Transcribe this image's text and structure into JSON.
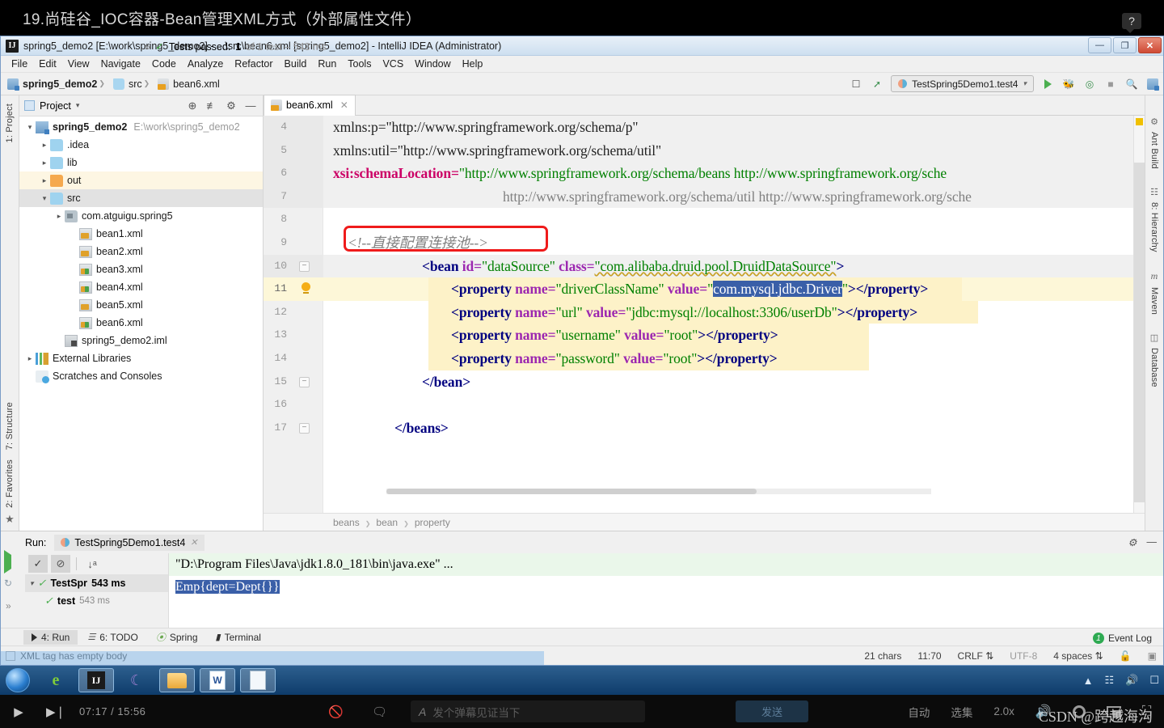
{
  "video": {
    "title": "19.尚硅谷_IOC容器-Bean管理XML方式（外部属性文件）",
    "help_glyph": "?",
    "player": {
      "play_icon": "▶",
      "next_icon": "▶❘",
      "time": "07:17 / 15:56",
      "danmu_off_icon": "danmu-off",
      "danmu_on_icon": "danmu-on",
      "font_icon": "A",
      "danmu_placeholder": "发个弹幕见证当下",
      "send_label": "发送",
      "auto_label": "自动",
      "episode_label": "选集",
      "speed_label": "2.0x",
      "watermark": "CSDN @跨越海沟"
    }
  },
  "window": {
    "title": "spring5_demo2 [E:\\work\\spring5_demo2] - ...\\src\\bean6.xml [spring5_demo2] - IntelliJ IDEA (Administrator)",
    "icon_label": "IJ",
    "minimize": "—",
    "maximize": "❐",
    "close": "✕"
  },
  "menubar": [
    "File",
    "Edit",
    "View",
    "Navigate",
    "Code",
    "Analyze",
    "Refactor",
    "Build",
    "Run",
    "Tools",
    "VCS",
    "Window",
    "Help"
  ],
  "navbar": {
    "crumbs": [
      {
        "label": "spring5_demo2",
        "icon": "module-icon",
        "bold": true
      },
      {
        "label": "src",
        "icon": "folder-icon",
        "bold": false
      },
      {
        "label": "bean6.xml",
        "icon": "xml-file-icon",
        "bold": false
      }
    ],
    "run_config": "TestSpring5Demo1.test4",
    "icons": [
      "make-project-icon",
      "hammer-icon",
      "run-icon",
      "debug-icon",
      "run-coverage-icon",
      "stop-icon",
      "search-everywhere-icon",
      "project-structure-icon"
    ]
  },
  "left_strip": {
    "project_label": "1: Project",
    "structure_label": "7: Structure",
    "favorites_label": "2: Favorites"
  },
  "right_strip": {
    "ant_label": "Ant Build",
    "hierarchy_label": "8: Hierarchy",
    "maven_label": "Maven",
    "database_label": "Database"
  },
  "project_panel": {
    "title": "Project",
    "dropdown_icon": "▾",
    "locate_icon": "⊕",
    "collapse_icon": "≢",
    "settings_icon": "⚙",
    "hide_icon": "—",
    "tree": [
      {
        "depth": 0,
        "arrow": "open",
        "icon": "module-icon",
        "label": "spring5_demo2",
        "bold": true,
        "suffix": "E:\\work\\spring5_demo2",
        "state": ""
      },
      {
        "depth": 1,
        "arrow": "closed",
        "icon": "folder-icon",
        "label": ".idea",
        "bold": false,
        "suffix": "",
        "state": ""
      },
      {
        "depth": 1,
        "arrow": "closed",
        "icon": "folder-icon",
        "label": "lib",
        "bold": false,
        "suffix": "",
        "state": ""
      },
      {
        "depth": 1,
        "arrow": "closed",
        "icon": "folder-orange-icon",
        "label": "out",
        "bold": false,
        "suffix": "",
        "state": "hl-out"
      },
      {
        "depth": 1,
        "arrow": "open",
        "icon": "folder-icon",
        "label": "src",
        "bold": false,
        "suffix": "",
        "state": "hl-src"
      },
      {
        "depth": 2,
        "arrow": "closed",
        "icon": "package-icon",
        "label": "com.atguigu.spring5",
        "bold": false,
        "suffix": "",
        "state": ""
      },
      {
        "depth": 3,
        "arrow": "none",
        "icon": "xml-file-icon",
        "label": "bean1.xml",
        "bold": false,
        "suffix": "",
        "state": ""
      },
      {
        "depth": 3,
        "arrow": "none",
        "icon": "xml-file-icon",
        "label": "bean2.xml",
        "bold": false,
        "suffix": "",
        "state": ""
      },
      {
        "depth": 3,
        "arrow": "none",
        "icon": "xml-file-green-icon",
        "label": "bean3.xml",
        "bold": false,
        "suffix": "",
        "state": ""
      },
      {
        "depth": 3,
        "arrow": "none",
        "icon": "xml-file-green-icon",
        "label": "bean4.xml",
        "bold": false,
        "suffix": "",
        "state": ""
      },
      {
        "depth": 3,
        "arrow": "none",
        "icon": "xml-file-icon",
        "label": "bean5.xml",
        "bold": false,
        "suffix": "",
        "state": ""
      },
      {
        "depth": 3,
        "arrow": "none",
        "icon": "xml-file-green-icon",
        "label": "bean6.xml",
        "bold": false,
        "suffix": "",
        "state": ""
      },
      {
        "depth": 2,
        "arrow": "none",
        "icon": "iml-file-icon",
        "label": "spring5_demo2.iml",
        "bold": false,
        "suffix": "",
        "state": ""
      },
      {
        "depth": 0,
        "arrow": "closed",
        "icon": "library-icon",
        "label": "External Libraries",
        "bold": false,
        "suffix": "",
        "state": ""
      },
      {
        "depth": 0,
        "arrow": "none",
        "icon": "scratch-icon",
        "label": "Scratches and Consoles",
        "bold": false,
        "suffix": "",
        "state": ""
      }
    ]
  },
  "editor": {
    "tab": {
      "label": "bean6.xml",
      "close_icon": "✕",
      "icon": "xml-file-icon"
    },
    "first_line_number": 4,
    "lines": [
      {
        "n": 4,
        "shade": true,
        "fold": false,
        "bulb": false
      },
      {
        "n": 5,
        "shade": true,
        "fold": false,
        "bulb": false
      },
      {
        "n": 6,
        "shade": true,
        "fold": false,
        "bulb": false
      },
      {
        "n": 7,
        "shade": true,
        "fold": false,
        "bulb": false
      },
      {
        "n": 8,
        "shade": false,
        "fold": false,
        "bulb": false
      },
      {
        "n": 9,
        "shade": false,
        "fold": false,
        "bulb": false
      },
      {
        "n": 10,
        "shade": true,
        "fold": true,
        "bulb": false
      },
      {
        "n": 11,
        "shade": false,
        "fold": false,
        "bulb": true
      },
      {
        "n": 12,
        "shade": false,
        "fold": false,
        "bulb": false
      },
      {
        "n": 13,
        "shade": false,
        "fold": false,
        "bulb": false
      },
      {
        "n": 14,
        "shade": false,
        "fold": false,
        "bulb": false
      },
      {
        "n": 15,
        "shade": false,
        "fold": true,
        "bulb": false
      },
      {
        "n": 16,
        "shade": false,
        "fold": false,
        "bulb": false
      },
      {
        "n": 17,
        "shade": false,
        "fold": true,
        "bulb": false
      }
    ],
    "code": {
      "l4": "xmlns:p=\"http://www.springframework.org/schema/p\"",
      "l5": "xmlns:util=\"http://www.springframework.org/schema/util\"",
      "l6_attr": "xsi:schemaLocation=",
      "l6_val": "\"http://www.springframework.org/schema/beans http://www.springframework.org/sche",
      "l7_val": "http://www.springframework.org/schema/util http://www.springframework.org/sche",
      "l9_comment": "<!--直接配置连接池-->",
      "l10_tag": "<bean ",
      "l10_a1": "id=",
      "l10_v1": "\"dataSource\"",
      "l10_a2": "class=",
      "l10_v2": "\"com.alibaba.druid.pool.DruidDataSource\"",
      "l10_close": ">",
      "l11_a1": "name=",
      "l11_v1": "\"driverClassName\"",
      "l11_a2": "value=",
      "l11_sel": "com.mysql.jdbc.Driver",
      "l12_v1": "\"url\"",
      "l12_v2": "\"jdbc:mysql://localhost:3306/userDb\"",
      "l13_v1": "\"username\"",
      "l13_v2": "\"root\"",
      "l14_v1": "\"password\"",
      "l14_v2": "\"root\"",
      "prop_open": "<property ",
      "prop_close": "</property>",
      "bean_close": "</bean>",
      "beans_close": "</beans>"
    },
    "breadcrumb": [
      "beans",
      "bean",
      "property"
    ]
  },
  "run_panel": {
    "label": "Run:",
    "tab": "TestSpring5Demo1.test4",
    "close_icon": "✕",
    "settings_icon": "⚙",
    "hide_icon": "—",
    "toolbar_icons": [
      "rerun-icon",
      "show-passed-icon",
      "hide-ignored-icon",
      "sort-alphabetically-icon",
      "expand-icon"
    ],
    "status_prefix": "Tests passed:",
    "status_count": "1",
    "status_suffix": "of 1 test – 543 ms",
    "tree": [
      {
        "label": "TestSpr",
        "time": "543 ms",
        "bold": true,
        "depth": 0,
        "selected": true
      },
      {
        "label": "test",
        "time": "543 ms",
        "bold": true,
        "depth": 1,
        "selected": false
      }
    ],
    "console": [
      {
        "text": "\"D:\\Program Files\\Java\\jdk1.8.0_181\\bin\\java.exe\" ...",
        "style": "green"
      },
      {
        "text": "Emp{dept=Dept{}}",
        "style": "selected"
      }
    ]
  },
  "bottom_tabs": [
    {
      "label": "4: Run",
      "icon": "run-icon",
      "active": true
    },
    {
      "label": "6: TODO",
      "icon": "todo-icon",
      "active": false
    },
    {
      "label": "Spring",
      "icon": "spring-leaf-icon",
      "active": false
    },
    {
      "label": "Terminal",
      "icon": "terminal-icon",
      "active": false
    }
  ],
  "statusbar": {
    "message": "XML tag has empty body",
    "chars": "21 chars",
    "caret": "11:70",
    "line_sep": "CRLF",
    "encoding": "UTF-8",
    "indent": "4 spaces",
    "lock_icon": "unlock-icon",
    "inspect_icon": "inspection-icon",
    "event_log": "Event Log",
    "event_count": "1"
  }
}
